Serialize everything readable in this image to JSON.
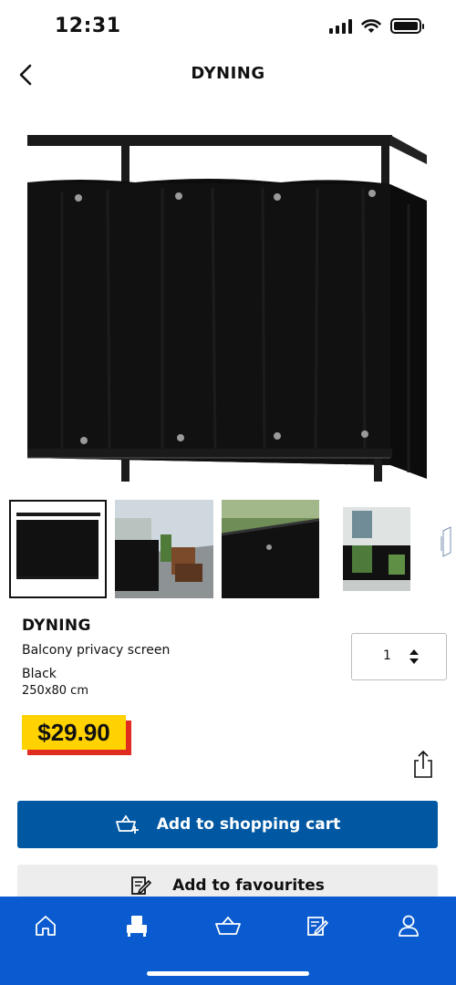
{
  "status_bar": {
    "time": "12:31"
  },
  "header": {
    "title": "DYNING"
  },
  "product": {
    "name": "DYNING",
    "description": "Balcony privacy screen",
    "color": "Black",
    "size": "250x80 cm",
    "price": "$29.90",
    "quantity": "1"
  },
  "thumbnails": [
    {
      "name": "black-screen-front",
      "selected": true
    },
    {
      "name": "balcony-with-furniture",
      "selected": false
    },
    {
      "name": "screen-closeup",
      "selected": false
    },
    {
      "name": "balcony-with-plants",
      "selected": false
    },
    {
      "name": "size-diagram",
      "selected": false
    }
  ],
  "actions": {
    "add_to_cart": "Add to shopping cart",
    "add_to_favourites": "Add to favourites"
  },
  "tab_bar": {
    "items": [
      {
        "icon": "home-icon"
      },
      {
        "icon": "products-icon",
        "active": true
      },
      {
        "icon": "basket-icon"
      },
      {
        "icon": "shopping-list-icon"
      },
      {
        "icon": "profile-icon"
      }
    ]
  },
  "colors": {
    "primary_blue": "#0058a3",
    "tab_bar_blue": "#0a5bcf",
    "price_yellow": "#ffd200",
    "price_red": "#e02b20"
  }
}
